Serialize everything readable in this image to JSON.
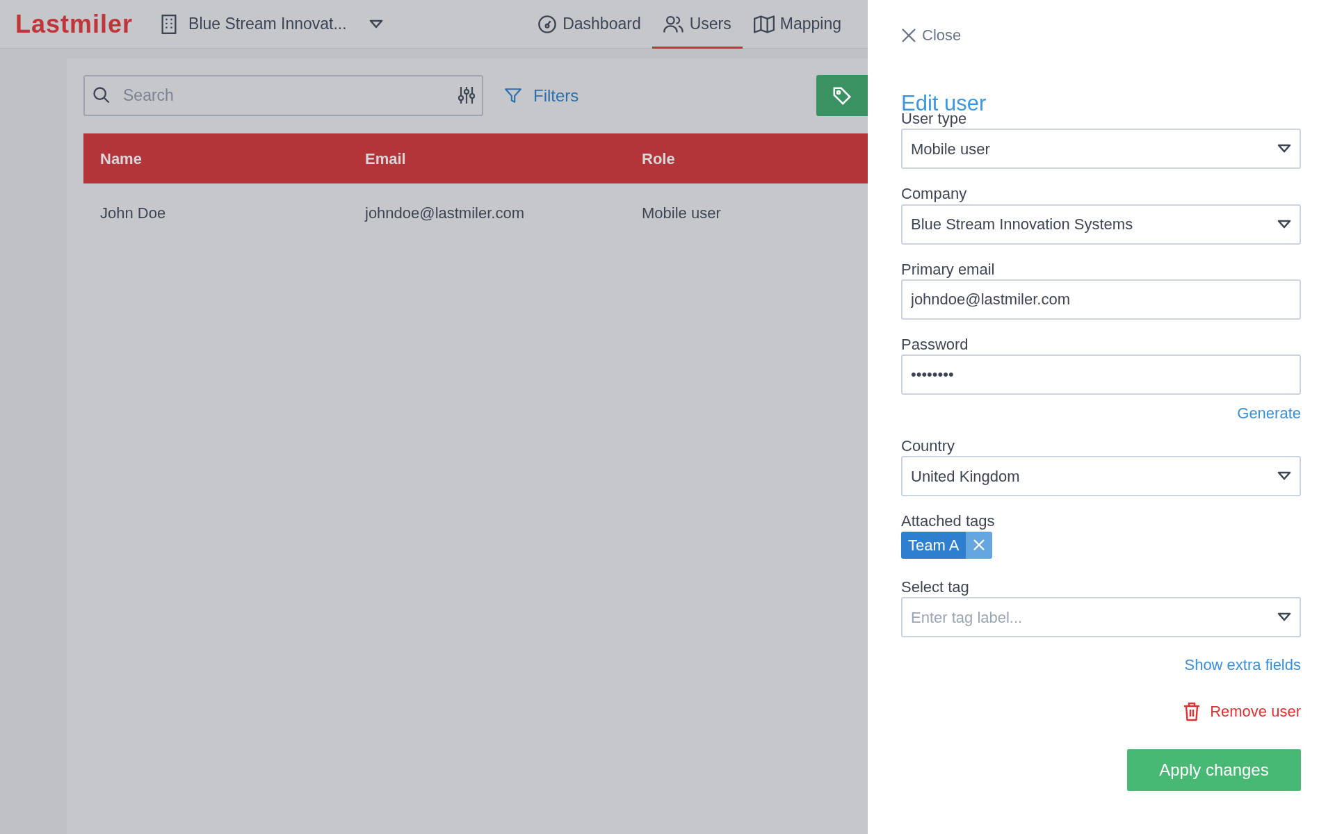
{
  "navbar": {
    "logo": "Lastmiler",
    "company": "Blue Stream Innovat...",
    "items": [
      {
        "label": "Dashboard",
        "selected": false
      },
      {
        "label": "Users",
        "selected": true
      },
      {
        "label": "Mapping",
        "selected": false
      }
    ]
  },
  "toolbar": {
    "search_placeholder": "Search",
    "filters": "Filters"
  },
  "table": {
    "columns": [
      "Name",
      "Email",
      "Role"
    ],
    "rows": [
      [
        "John Doe",
        "johndoe@lastmiler.com",
        "Mobile user"
      ]
    ]
  },
  "panel": {
    "close": "Close",
    "title": "Edit user",
    "fields": [
      {
        "kind": "select",
        "label": "User type",
        "value": "Mobile user"
      },
      {
        "kind": "select",
        "label": "Company",
        "value": "Blue Stream Innovation Systems"
      },
      {
        "kind": "input",
        "label": "Primary email",
        "value": "johndoe@lastmiler.com"
      },
      {
        "kind": "input",
        "label": "Password",
        "value": "••••••••",
        "action": "Generate"
      },
      {
        "kind": "select",
        "label": "Country",
        "value": "United Kingdom"
      },
      {
        "kind": "tags",
        "label": "Attached tags",
        "tags": [
          "Team A"
        ]
      },
      {
        "kind": "select",
        "label": "Select tag",
        "placeholder": "Enter tag label..."
      }
    ],
    "extra_link": "Show extra fields",
    "remove": "Remove user",
    "apply": "Apply changes"
  }
}
